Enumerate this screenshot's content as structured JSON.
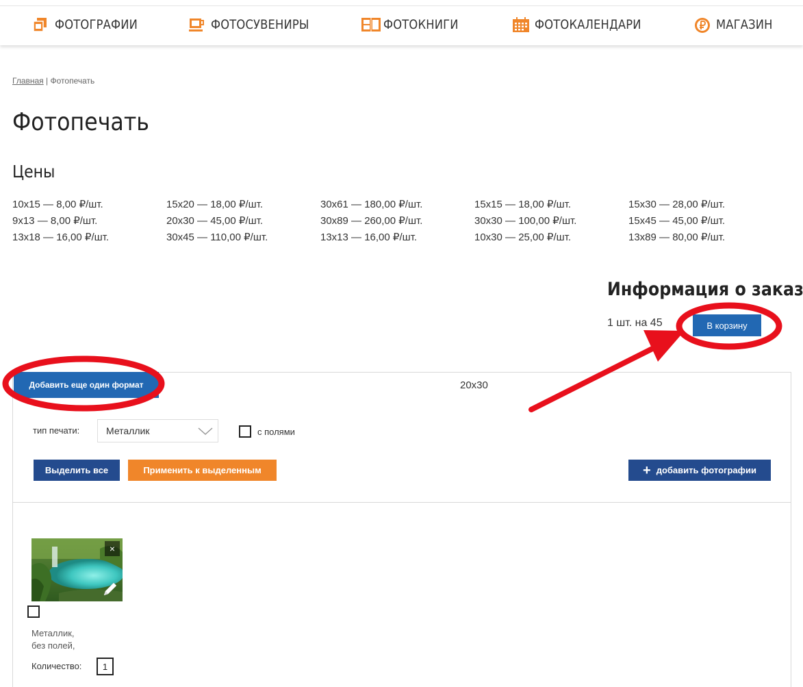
{
  "nav": {
    "items": [
      {
        "label": "ФОТОГРАФИИ",
        "icon": "photos-icon"
      },
      {
        "label": "ФОТОСУВЕНИРЫ",
        "icon": "mug-icon"
      },
      {
        "label": "ФОТОКНИГИ",
        "icon": "photobook-icon"
      },
      {
        "label": "ФОТОКАЛЕНДАРИ",
        "icon": "calendar-icon"
      },
      {
        "label": "МАГАЗИН",
        "icon": "ruble-icon"
      }
    ],
    "accent": "#f0862a"
  },
  "breadcrumb": {
    "home": "Главная",
    "separator": "|",
    "current": "Фотопечать"
  },
  "page_title": "Фотопечать",
  "prices": {
    "title": "Цены",
    "columns": [
      [
        "10x15 — 8,00 ₽/шт.",
        "9x13 — 8,00 ₽/шт.",
        "13x18 — 16,00 ₽/шт."
      ],
      [
        "15x20 — 18,00 ₽/шт.",
        "20x30 — 45,00 ₽/шт.",
        "30x45 — 110,00 ₽/шт."
      ],
      [
        "30x61 — 180,00 ₽/шт.",
        "30x89 — 260,00 ₽/шт.",
        "13x13 — 16,00 ₽/шт."
      ],
      [
        "15x15 — 18,00 ₽/шт.",
        "30x30 — 100,00 ₽/шт.",
        "10x30 — 25,00 ₽/шт."
      ],
      [
        "15x30 — 28,00 ₽/шт.",
        "15x45 — 45,00 ₽/шт.",
        "13x89 — 80,00 ₽/шт."
      ]
    ]
  },
  "order": {
    "title": "Информация о заказе",
    "summary": "1 шт. на 45",
    "cart_button": "В корзину"
  },
  "format": {
    "add_button": "Добавить еще один формат",
    "size": "20x30",
    "print_type_label": "тип печати:",
    "print_type_value": "Металлик",
    "margins_label": "с полями",
    "select_all_button": "Выделить все",
    "apply_button": "Применить к выделенным",
    "add_photos_button": "добавить фотографии"
  },
  "photo": {
    "close_glyph": "×",
    "desc_line1": "Металлик,",
    "desc_line2": "без полей,",
    "quantity_label": "Количество:",
    "quantity_value": "1"
  },
  "colors": {
    "primary_blue": "#2268b3",
    "dark_blue": "#244b8e",
    "orange": "#f0862a",
    "annotation_red": "#e8101c"
  }
}
